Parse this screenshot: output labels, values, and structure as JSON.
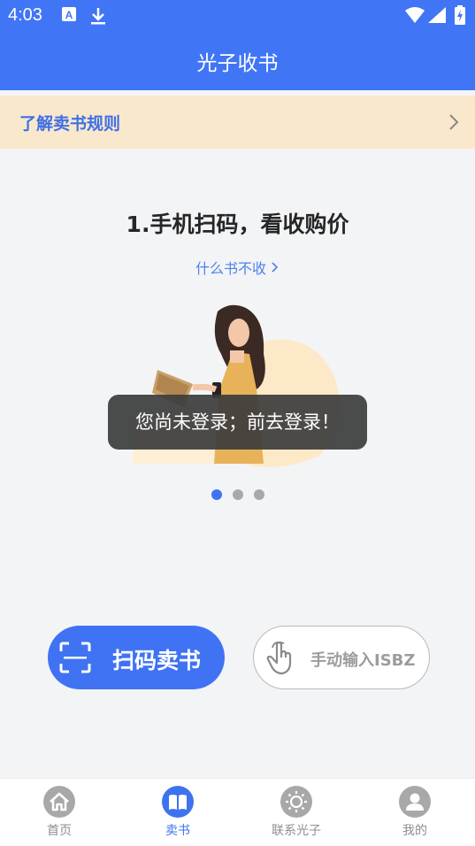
{
  "status_bar": {
    "time": "4:03"
  },
  "header": {
    "title": "光子收书"
  },
  "rules_banner": {
    "label": "了解卖书规则"
  },
  "step": {
    "title": "1.手机扫码，看收购价",
    "link": "什么书不收"
  },
  "toast": {
    "message": "您尚未登录；前去登录！"
  },
  "carousel": {
    "count": 3,
    "active_index": 0
  },
  "actions": {
    "scan_label": "扫码卖书",
    "manual_label": "手动输入ISBZ"
  },
  "bottom_nav": {
    "items": [
      {
        "label": "首页",
        "icon": "home-icon",
        "active": false
      },
      {
        "label": "卖书",
        "icon": "book-icon",
        "active": true
      },
      {
        "label": "联系光子",
        "icon": "sun-icon",
        "active": false
      },
      {
        "label": "我的",
        "icon": "user-icon",
        "active": false
      }
    ]
  },
  "colors": {
    "primary": "#4076f6",
    "banner": "#fae8cd",
    "inactive": "#a8a8a8"
  }
}
